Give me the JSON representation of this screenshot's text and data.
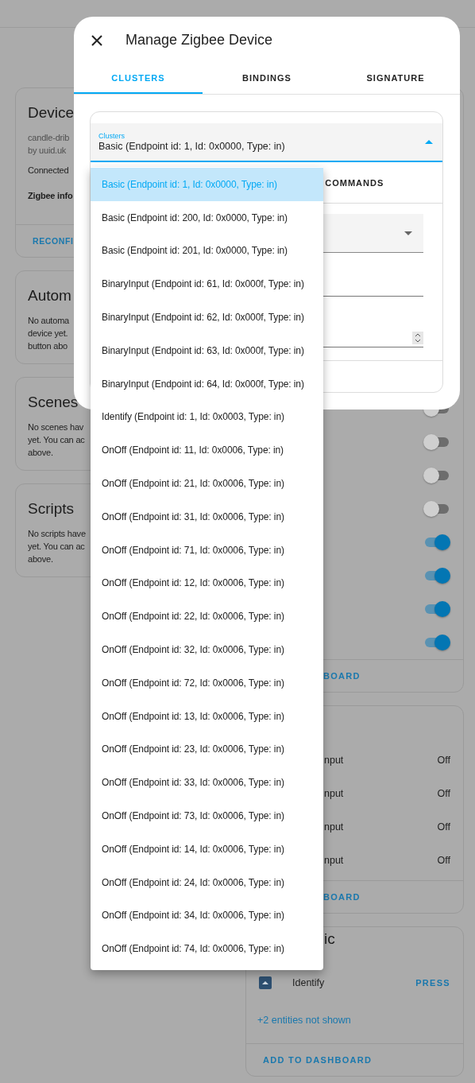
{
  "left_cards": [
    {
      "kind": "device",
      "title": "Device",
      "lines": [
        "candle-drib",
        "by uuid.uk"
      ],
      "status": "Connected",
      "info": "Zigbee info",
      "button": "RECONFI"
    },
    {
      "kind": "empty",
      "title": "Autom",
      "lines": [
        "No automa",
        "device yet.",
        "button abo"
      ]
    },
    {
      "kind": "empty",
      "title": "Scenes",
      "lines": [
        "No scenes hav",
        "yet. You can ac",
        "above."
      ]
    },
    {
      "kind": "empty",
      "title": "Scripts",
      "lines": [
        "No scripts have",
        "yet. You can ac",
        "above."
      ]
    }
  ],
  "switch_card": {
    "switches": [
      {
        "on": false
      },
      {
        "on": false
      },
      {
        "on": false
      },
      {
        "on": false
      },
      {
        "on": true
      },
      {
        "on": true
      },
      {
        "on": true
      },
      {
        "on": true
      }
    ],
    "button": "BOARD"
  },
  "sensor_card": {
    "rows": [
      {
        "name": "nput",
        "state": "Off"
      },
      {
        "name": "nput",
        "state": "Off"
      },
      {
        "name": "nput",
        "state": "Off"
      },
      {
        "name": "nput",
        "state": "Off"
      }
    ],
    "button": "BOARD"
  },
  "button_card": {
    "title": "ic",
    "entity": {
      "name": "Identify",
      "action": "PRESS"
    },
    "more": "+2 entities not shown",
    "button": "ADD TO DASHBOARD"
  },
  "dialog": {
    "title": "Manage Zigbee Device",
    "tabs": [
      {
        "label": "CLUSTERS",
        "selected": true
      },
      {
        "label": "BINDINGS",
        "selected": false
      },
      {
        "label": "SIGNATURE",
        "selected": false
      }
    ],
    "cluster_select": {
      "label": "Clusters",
      "value": "Basic (Endpoint id: 1, Id: 0x0000, Type: in)",
      "expanded": true
    },
    "sub_tab": "COMMANDS",
    "options": [
      {
        "label": "Basic (Endpoint id: 1, Id: 0x0000, Type: in)",
        "selected": true
      },
      {
        "label": "Basic (Endpoint id: 200, Id: 0x0000, Type: in)",
        "selected": false
      },
      {
        "label": "Basic (Endpoint id: 201, Id: 0x0000, Type: in)",
        "selected": false
      },
      {
        "label": "BinaryInput (Endpoint id: 61, Id: 0x000f, Type: in)",
        "selected": false
      },
      {
        "label": "BinaryInput (Endpoint id: 62, Id: 0x000f, Type: in)",
        "selected": false
      },
      {
        "label": "BinaryInput (Endpoint id: 63, Id: 0x000f, Type: in)",
        "selected": false
      },
      {
        "label": "BinaryInput (Endpoint id: 64, Id: 0x000f, Type: in)",
        "selected": false
      },
      {
        "label": "Identify (Endpoint id: 1, Id: 0x0003, Type: in)",
        "selected": false
      },
      {
        "label": "OnOff (Endpoint id: 11, Id: 0x0006, Type: in)",
        "selected": false
      },
      {
        "label": "OnOff (Endpoint id: 21, Id: 0x0006, Type: in)",
        "selected": false
      },
      {
        "label": "OnOff (Endpoint id: 31, Id: 0x0006, Type: in)",
        "selected": false
      },
      {
        "label": "OnOff (Endpoint id: 71, Id: 0x0006, Type: in)",
        "selected": false
      },
      {
        "label": "OnOff (Endpoint id: 12, Id: 0x0006, Type: in)",
        "selected": false
      },
      {
        "label": "OnOff (Endpoint id: 22, Id: 0x0006, Type: in)",
        "selected": false
      },
      {
        "label": "OnOff (Endpoint id: 32, Id: 0x0006, Type: in)",
        "selected": false
      },
      {
        "label": "OnOff (Endpoint id: 72, Id: 0x0006, Type: in)",
        "selected": false
      },
      {
        "label": "OnOff (Endpoint id: 13, Id: 0x0006, Type: in)",
        "selected": false
      },
      {
        "label": "OnOff (Endpoint id: 23, Id: 0x0006, Type: in)",
        "selected": false
      },
      {
        "label": "OnOff (Endpoint id: 33, Id: 0x0006, Type: in)",
        "selected": false
      },
      {
        "label": "OnOff (Endpoint id: 73, Id: 0x0006, Type: in)",
        "selected": false
      },
      {
        "label": "OnOff (Endpoint id: 14, Id: 0x0006, Type: in)",
        "selected": false
      },
      {
        "label": "OnOff (Endpoint id: 24, Id: 0x0006, Type: in)",
        "selected": false
      },
      {
        "label": "OnOff (Endpoint id: 34, Id: 0x0006, Type: in)",
        "selected": false
      },
      {
        "label": "OnOff (Endpoint id: 74, Id: 0x0006, Type: in)",
        "selected": false
      }
    ]
  }
}
